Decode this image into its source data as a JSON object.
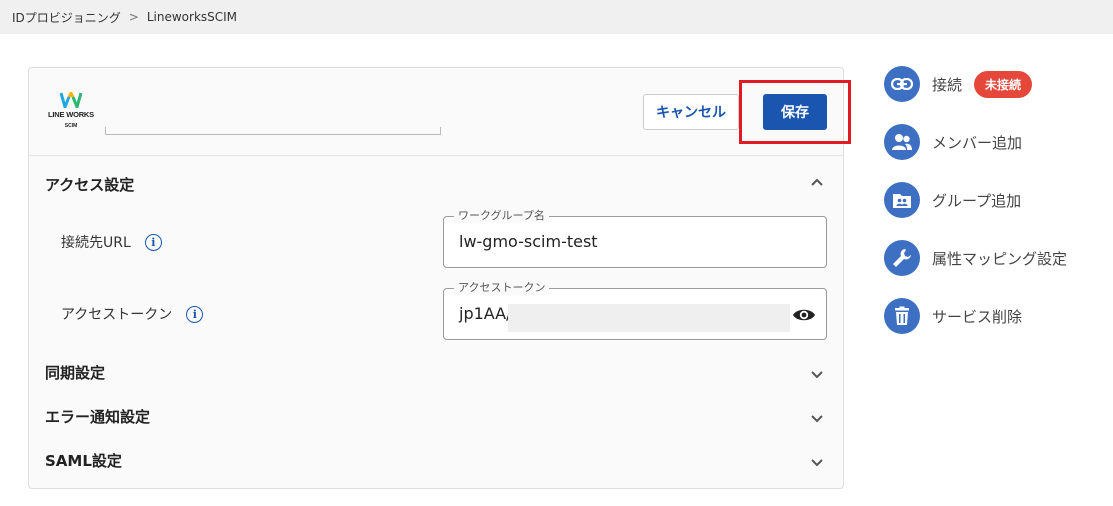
{
  "breadcrumb": {
    "root": "IDプロビジョニング",
    "separator": ">",
    "current": "LineworksSCIM"
  },
  "logo": {
    "line1": "LINE WORKS",
    "line2": "SCIM"
  },
  "actions": {
    "cancel_label": "キャンセル",
    "save_label": "保存"
  },
  "access_settings": {
    "title": "アクセス設定",
    "rows": [
      {
        "label": "接続先URL",
        "field_legend": "ワークグループ名",
        "field_value": "lw-gmo-scim-test"
      },
      {
        "label": "アクセストークン",
        "field_legend": "アクセストークン",
        "field_value": "jp1AA/"
      }
    ]
  },
  "sections": [
    {
      "title": "同期設定"
    },
    {
      "title": "エラー通知設定"
    },
    {
      "title": "SAML設定"
    }
  ],
  "sidebar": {
    "items": [
      {
        "label": "接続",
        "icon": "link-icon",
        "badge": "未接続"
      },
      {
        "label": "メンバー追加",
        "icon": "group-icon"
      },
      {
        "label": "グループ追加",
        "icon": "folder-group-icon"
      },
      {
        "label": "属性マッピング設定",
        "icon": "wrench-icon"
      },
      {
        "label": "サービス削除",
        "icon": "trash-icon"
      }
    ]
  },
  "colors": {
    "primary": "#1a56b0",
    "icon_bg": "#3d6fc3",
    "badge": "#e5483b",
    "highlight": "#e01b24"
  }
}
